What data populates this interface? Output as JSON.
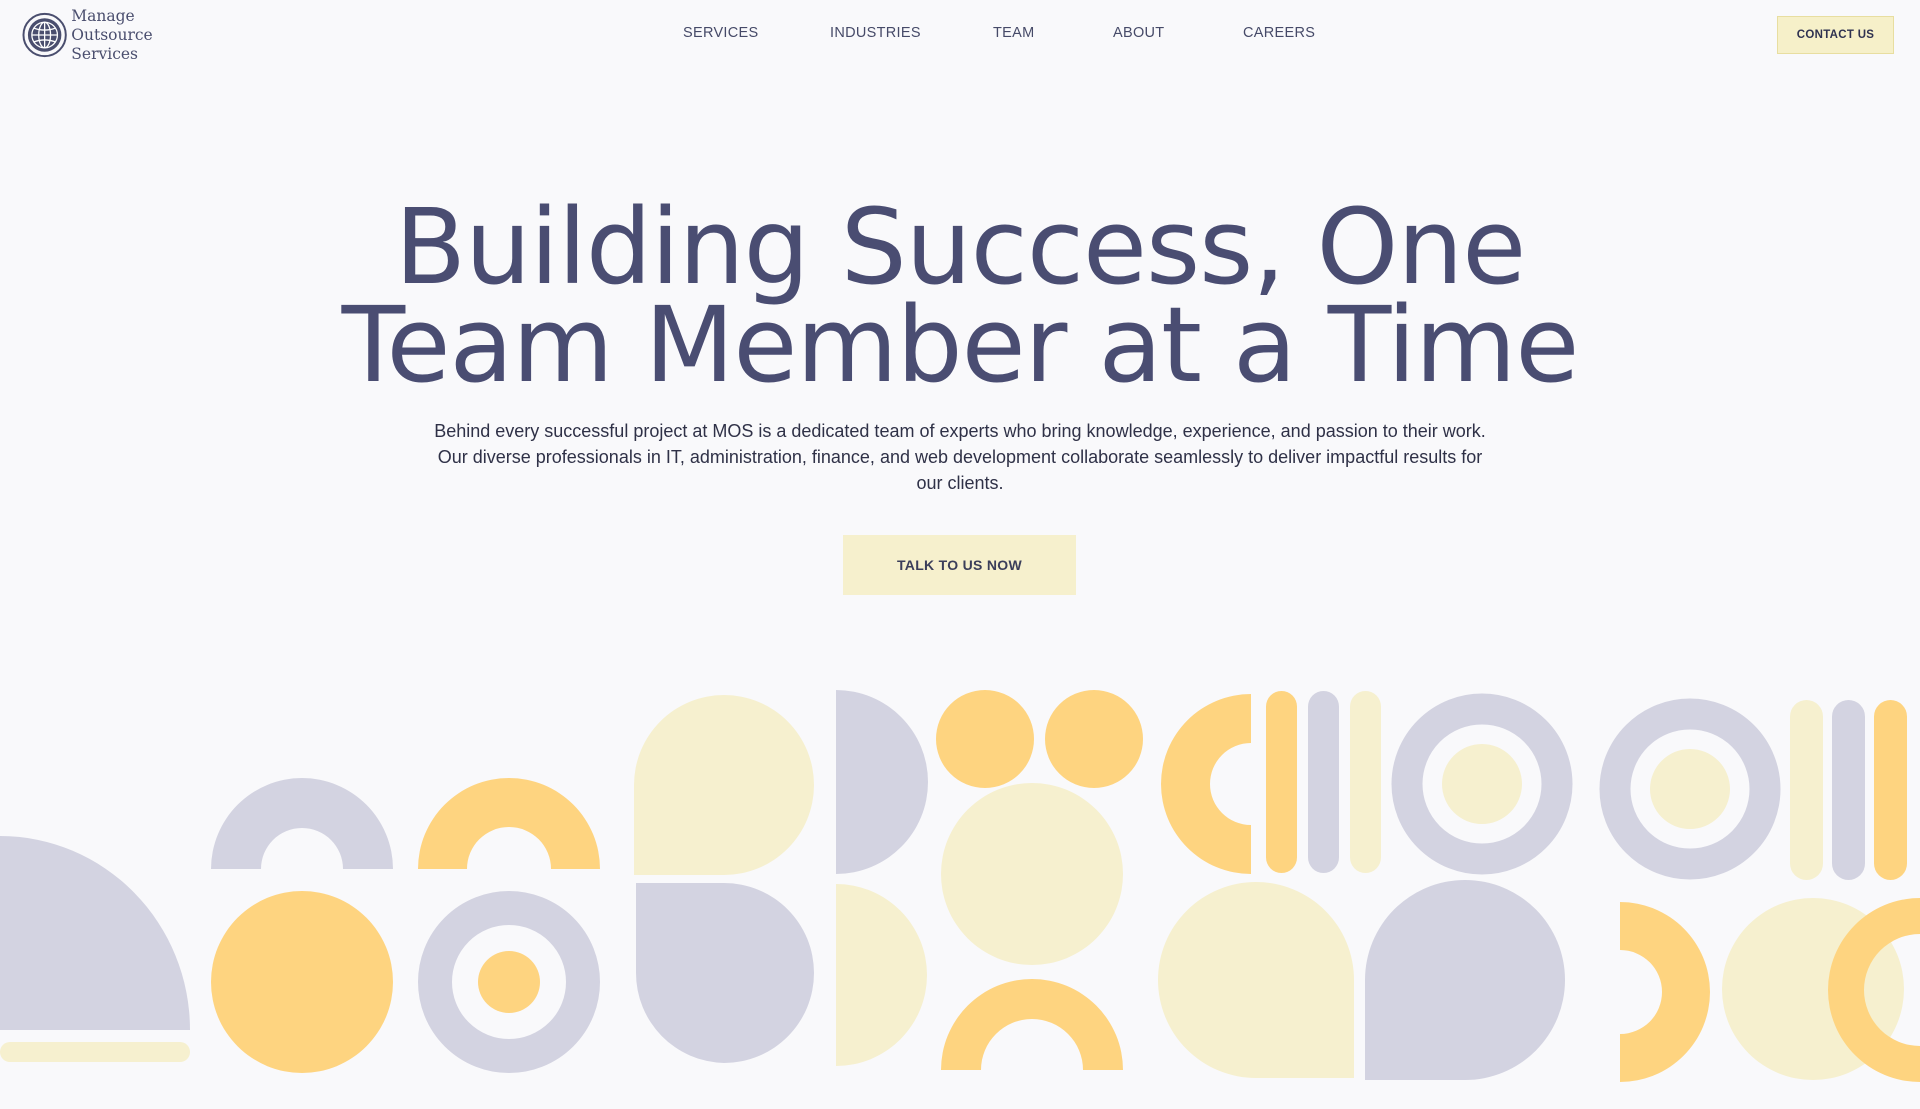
{
  "brand": {
    "name_line1": "Manage",
    "name_line2": "Outsource Services"
  },
  "nav": {
    "items": [
      "SERVICES",
      "INDUSTRIES",
      "TEAM",
      "ABOUT",
      "CAREERS"
    ]
  },
  "header": {
    "contact_label": "CONTACT US"
  },
  "hero": {
    "title_line1": "Building Success, One",
    "title_line2": "Team Member at a Time",
    "subtitle_line1": "Behind every successful project at MOS is a dedicated team of experts who bring knowledge, experience, and passion to their work.",
    "subtitle_line2": "Our diverse professionals in IT, administration, finance, and web development collaborate seamlessly to deliver impactful results for",
    "subtitle_line3": "our clients.",
    "cta_label": "TALK TO US NOW"
  },
  "colors": {
    "title": "#4a4d72",
    "accent_yellow": "#fed480",
    "pale_yellow": "#f6f0cf",
    "lavender": "#d3d3e1",
    "background": "#f9f9fb"
  }
}
